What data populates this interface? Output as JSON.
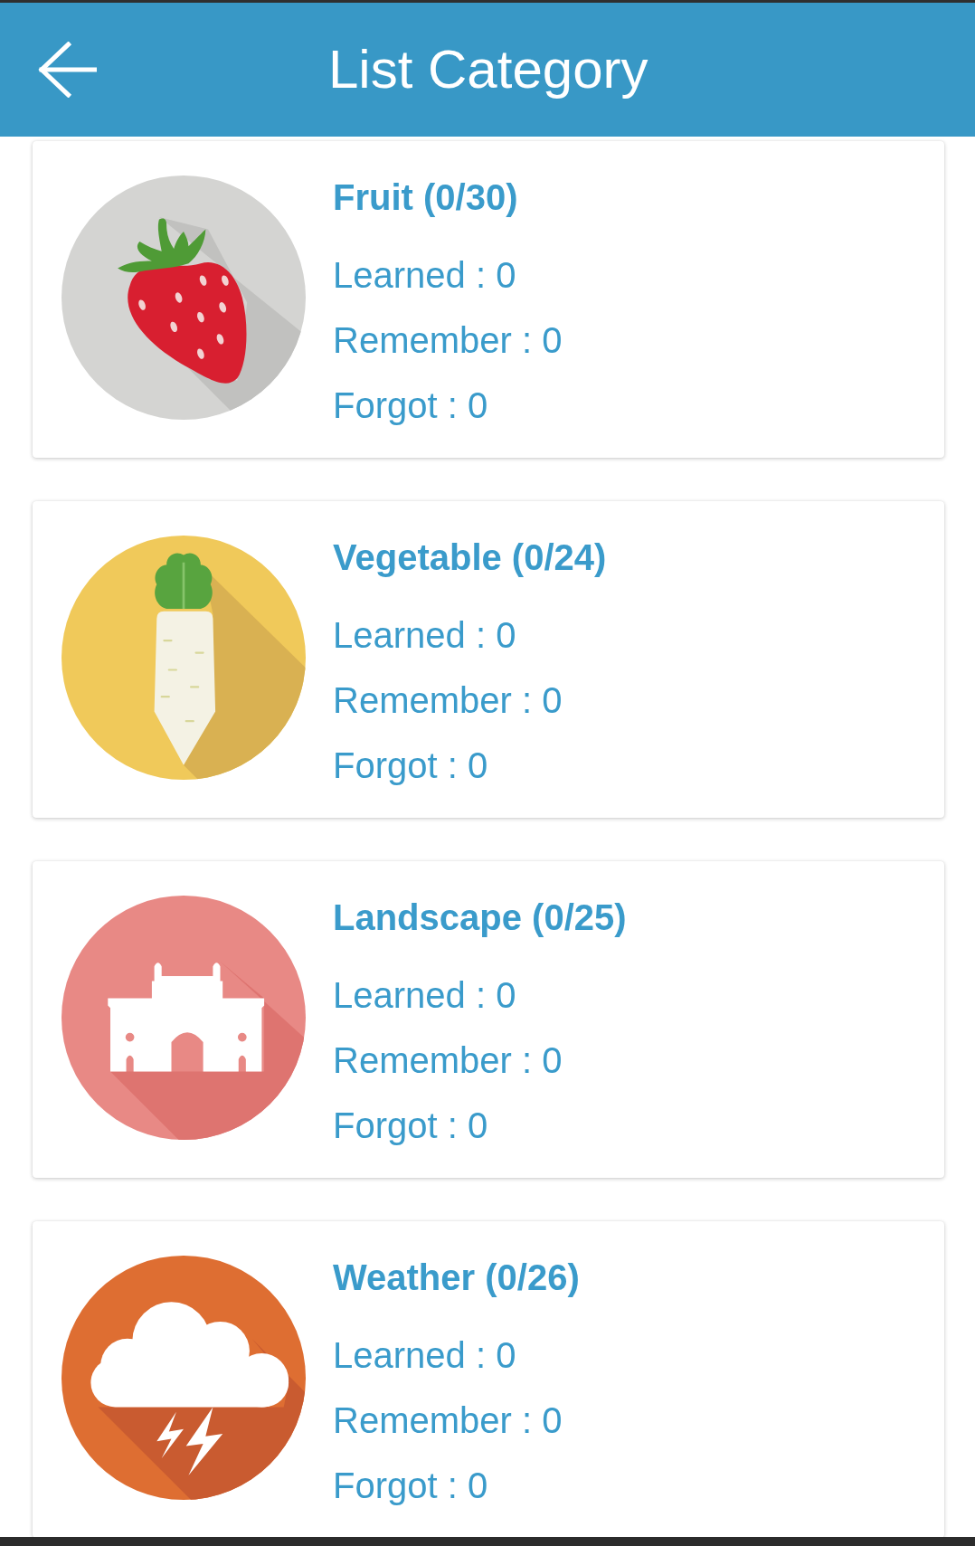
{
  "app_bar": {
    "title": "List Category"
  },
  "categories": [
    {
      "title": "Fruit (0/30)",
      "stats": [
        "Learned : 0",
        "Remember : 0",
        "Forgot : 0"
      ]
    },
    {
      "title": "Vegetable (0/24)",
      "stats": [
        "Learned : 0",
        "Remember : 0",
        "Forgot : 0"
      ]
    },
    {
      "title": "Landscape (0/25)",
      "stats": [
        "Learned : 0",
        "Remember : 0",
        "Forgot : 0"
      ]
    },
    {
      "title": "Weather (0/26)",
      "stats": [
        "Learned : 0",
        "Remember : 0",
        "Forgot : 0"
      ]
    }
  ]
}
